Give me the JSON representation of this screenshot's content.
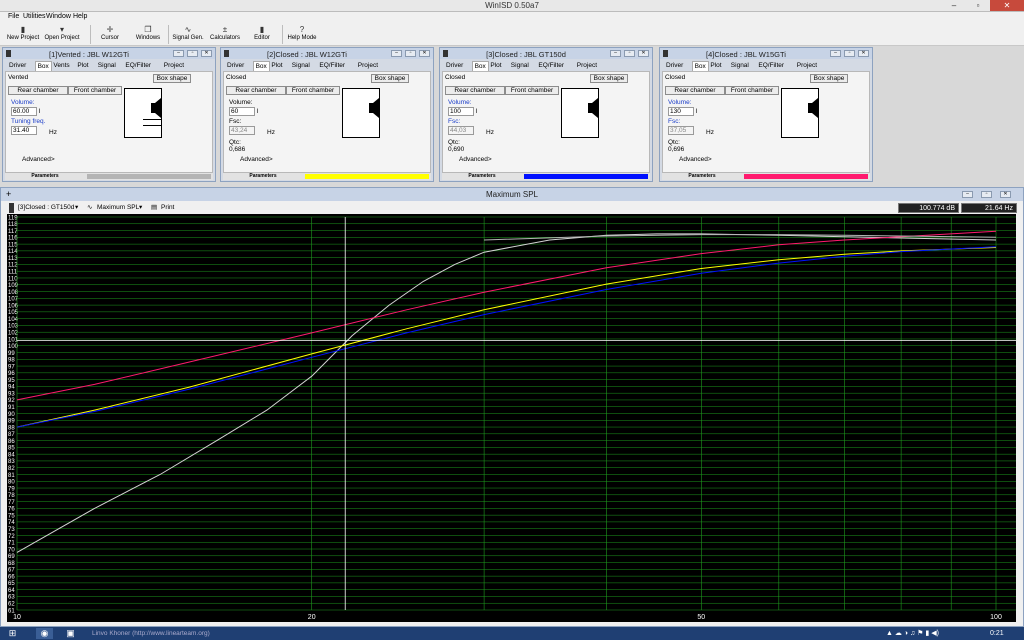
{
  "app": {
    "title": "WinISD 0.50a7"
  },
  "window_controls": {
    "minimize": "–",
    "maximize": "▫",
    "close": "✕"
  },
  "menu": [
    {
      "label": "File"
    },
    {
      "label": "Utilities"
    },
    {
      "label": "Window"
    },
    {
      "label": "Help"
    }
  ],
  "toolbar": [
    {
      "label": "New Project",
      "icon": "new-project-icon",
      "glyph": "▮"
    },
    {
      "label": "Open Project",
      "icon": "open-project-icon",
      "glyph": "▾"
    },
    {
      "label": "Cursor",
      "icon": "cursor-icon",
      "glyph": "✛"
    },
    {
      "label": "Windows",
      "icon": "windows-icon",
      "glyph": "❐"
    },
    {
      "label": "Signal Gen.",
      "icon": "signal-gen-icon",
      "glyph": "∿"
    },
    {
      "label": "Calculators",
      "icon": "calculator-icon",
      "glyph": "±"
    },
    {
      "label": "Editor",
      "icon": "editor-icon",
      "glyph": "▮"
    },
    {
      "label": "Help Mode",
      "icon": "help-icon",
      "glyph": "?"
    }
  ],
  "projects": [
    {
      "title": "[1]Vented : JBL W12GTi",
      "tabs": [
        "Driver",
        "Box",
        "Vents",
        "Plot",
        "Signal",
        "EQ/Filter",
        "Project"
      ],
      "selected_tab": "Box",
      "box_type": "Vented",
      "box_shape_button": "Box shape",
      "rear_chamber": "Rear chamber",
      "front_chamber": "Front chamber",
      "fields": [
        {
          "label": "Volume:",
          "value": "60.00",
          "unit": "l",
          "blue": true,
          "readonly": false
        },
        {
          "label": "Tuning freq.",
          "value": "31.40",
          "unit": "Hz",
          "blue": true,
          "readonly": false
        }
      ],
      "qtc_label": "",
      "qtc_value": "",
      "advanced": "Advanced>",
      "footer_label": "Parameters",
      "color": "#b4b4b4",
      "vented": true
    },
    {
      "title": "[2]Closed : JBL W12GTi",
      "tabs": [
        "Driver",
        "Box",
        "Plot",
        "Signal",
        "EQ/Filter",
        "Project"
      ],
      "selected_tab": "Box",
      "box_type": "Closed",
      "box_shape_button": "Box shape",
      "rear_chamber": "Rear chamber",
      "front_chamber": "Front chamber",
      "fields": [
        {
          "label": "Volume:",
          "value": "60",
          "unit": "l",
          "blue": false,
          "readonly": false
        },
        {
          "label": "Fsc:",
          "value": "43,24",
          "unit": "Hz",
          "blue": false,
          "readonly": true
        }
      ],
      "qtc_label": "Qtc:",
      "qtc_value": "0,686",
      "advanced": "Advanced>",
      "footer_label": "Parameters",
      "color": "#ffff00",
      "vented": false
    },
    {
      "title": "[3]Closed : JBL GT150d",
      "tabs": [
        "Driver",
        "Box",
        "Plot",
        "Signal",
        "EQ/Filter",
        "Project"
      ],
      "selected_tab": "Box",
      "box_type": "Closed",
      "box_shape_button": "Box shape",
      "rear_chamber": "Rear chamber",
      "front_chamber": "Front chamber",
      "fields": [
        {
          "label": "Volume:",
          "value": "100",
          "unit": "l",
          "blue": true,
          "readonly": false
        },
        {
          "label": "Fsc:",
          "value": "44,03",
          "unit": "Hz",
          "blue": true,
          "readonly": true
        }
      ],
      "qtc_label": "Qtc:",
      "qtc_value": "0,690",
      "advanced": "Advanced>",
      "footer_label": "Parameters",
      "color": "#0010ff",
      "vented": false
    },
    {
      "title": "[4]Closed : JBL W15GTi",
      "tabs": [
        "Driver",
        "Box",
        "Plot",
        "Signal",
        "EQ/Filter",
        "Project"
      ],
      "selected_tab": "Box",
      "box_type": "Closed",
      "box_shape_button": "Box shape",
      "rear_chamber": "Rear chamber",
      "front_chamber": "Front chamber",
      "fields": [
        {
          "label": "Volume:",
          "value": "130",
          "unit": "l",
          "blue": true,
          "readonly": false
        },
        {
          "label": "Fsc:",
          "value": "37,05",
          "unit": "Hz",
          "blue": true,
          "readonly": true
        }
      ],
      "qtc_label": "Qtc:",
      "qtc_value": "0,696",
      "advanced": "Advanced>",
      "footer_label": "Parameters",
      "color": "#ff1a6e",
      "vented": false
    }
  ],
  "spl_window": {
    "title": "Maximum SPL",
    "project_select": "[3]Closed : GT150d",
    "plot_select": "Maximum SPL",
    "print_label": "Print",
    "readout_db": "100.774 dB",
    "readout_hz": "21.64 Hz",
    "expand_icon": "+"
  },
  "chart_data": {
    "type": "line",
    "title": "",
    "xlabel": "",
    "ylabel": "",
    "x_scale": "log",
    "xlim": [
      10,
      100
    ],
    "ylim": [
      61,
      119
    ],
    "x_tick_labels": [
      "10",
      "20",
      "50",
      "100"
    ],
    "y_ticks": [
      61,
      62,
      63,
      64,
      65,
      66,
      67,
      68,
      69,
      70,
      71,
      72,
      73,
      74,
      75,
      76,
      77,
      78,
      79,
      80,
      81,
      82,
      83,
      84,
      85,
      86,
      87,
      88,
      89,
      90,
      91,
      92,
      93,
      94,
      95,
      96,
      97,
      98,
      99,
      100,
      101,
      102,
      103,
      104,
      105,
      106,
      107,
      108,
      109,
      110,
      111,
      112,
      113,
      114,
      115,
      116,
      117,
      118,
      119
    ],
    "grid": true,
    "background": "#000000",
    "grid_color": "#1e9a1e",
    "cursor": {
      "x": 21.64,
      "y": 100.774,
      "color": "#ffffff"
    },
    "series": [
      {
        "color": "#d4d4d4",
        "x": [
          10,
          12,
          14,
          16,
          18,
          20,
          22,
          24,
          26,
          28,
          30,
          35,
          40,
          45,
          50,
          60,
          70,
          80,
          100
        ],
        "y": [
          69.5,
          76,
          81,
          86,
          90.5,
          95.5,
          101.5,
          106,
          109.5,
          112,
          113.8,
          115.6,
          116.3,
          116.5,
          116.5,
          116.3,
          116.1,
          115.9,
          115.6
        ]
      },
      {
        "color": "#ff1a6e",
        "x": [
          10,
          12,
          15,
          20,
          25,
          30,
          40,
          50,
          60,
          70,
          80,
          100
        ],
        "y": [
          92,
          94.3,
          97.6,
          101.9,
          105.3,
          107.9,
          111.5,
          113.6,
          114.9,
          115.6,
          116.1,
          116.9
        ]
      },
      {
        "color": "#ffff00",
        "x": [
          10,
          12,
          15,
          20,
          25,
          30,
          40,
          50,
          60,
          70,
          80,
          100
        ],
        "y": [
          88,
          90.5,
          93.9,
          98.8,
          102.5,
          105.3,
          109.1,
          111.4,
          112.7,
          113.5,
          114.0,
          114.5
        ]
      },
      {
        "color": "#0010ff",
        "x": [
          10,
          12,
          15,
          20,
          25,
          30,
          40,
          50,
          60,
          70,
          80,
          100
        ],
        "y": [
          88,
          90.3,
          93.6,
          98.3,
          101.9,
          104.6,
          108.3,
          110.7,
          112.2,
          113.2,
          113.9,
          114.6
        ]
      },
      {
        "color": "#b4b4b4",
        "x": [
          30,
          40,
          50,
          60,
          70,
          80,
          100
        ],
        "y": [
          115.6,
          116.2,
          116.4,
          116.4,
          116.3,
          116.2,
          116.0
        ]
      }
    ]
  },
  "taskbar": {
    "start_icon": "⊞",
    "apps": [
      {
        "icon": "chrome-icon",
        "glyph": "◉"
      },
      {
        "icon": "app-window-icon",
        "glyph": "▣"
      }
    ],
    "running_text": "Linvo Khoner (http://www.linearteam.org)",
    "clock": "0:21",
    "tray_glyphs": "▲ ☁ ◑ ♫ ⚑ ▮ ◀)"
  }
}
